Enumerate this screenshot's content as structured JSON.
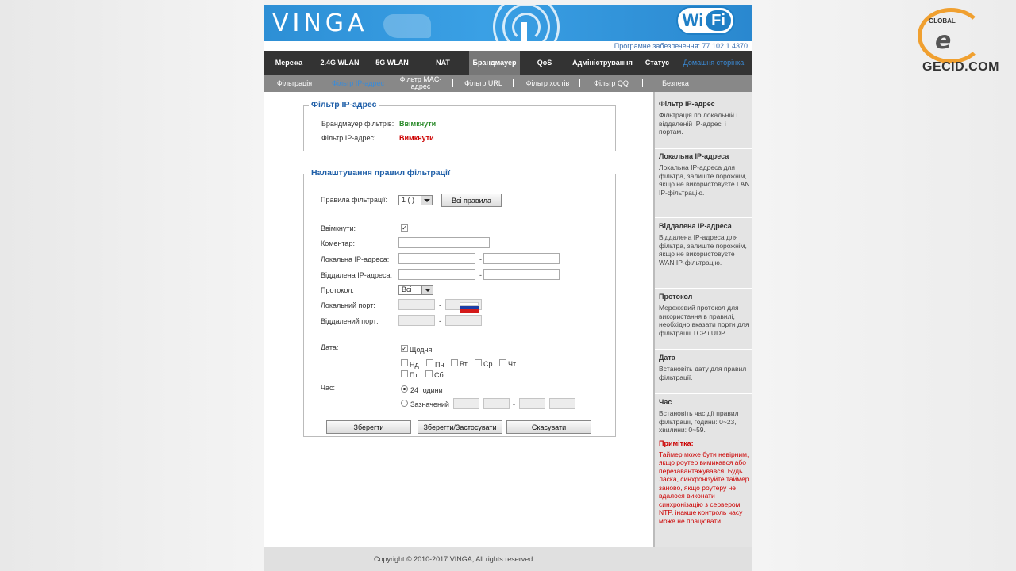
{
  "header": {
    "logo": "VINGA",
    "wifi_wi": "Wi",
    "wifi_fi": "Fi",
    "firmware": "Програмне забезпечення: 77.102.1.4370"
  },
  "nav": {
    "items": [
      "Мережа",
      "2.4G WLAN",
      "5G WLAN",
      "NAT",
      "Брандмауер",
      "QoS",
      "Адміністрування",
      "Статус",
      "Домашня сторінка"
    ]
  },
  "subnav": {
    "items": [
      "Фільтрація",
      "Фільтр IP-адрес",
      "Фільтр MAC-адрес",
      "Фільтр URL",
      "Фільтр хостів",
      "Фільтр QQ",
      "Безпека"
    ]
  },
  "ip_filter": {
    "legend": "Фільтр IP-адрес",
    "firewall_label": "Брандмауер фільтрів:",
    "firewall_value": "Ввімкнути",
    "ipfilter_label": "Фільтр IP-адрес:",
    "ipfilter_value": "Вимкнути"
  },
  "rules": {
    "legend": "Налаштування правил фільтрації",
    "rules_label": "Правила фільтрації:",
    "rules_value": "1 ( )",
    "all_rules_button": "Всі правила",
    "enable_label": "Ввімкнути:",
    "comment_label": "Коментар:",
    "local_ip_label": "Локальна IP-адреса:",
    "remote_ip_label": "Віддалена IP-адреса:",
    "protocol_label": "Протокол:",
    "protocol_value": "Всі",
    "local_port_label": "Локальний порт:",
    "remote_port_label": "Віддалений порт:",
    "date_label": "Дата:",
    "daily_label": "Щодня",
    "days": [
      "Нд",
      "Пн",
      "Вт",
      "Ср",
      "Чт",
      "Пт",
      "Сб"
    ],
    "time_label": "Час:",
    "time_24h": "24 години",
    "time_custom": "Зазначений",
    "dash": "-",
    "save_button": "Зберегти",
    "save_apply_button": "Зберегти/Застосувати",
    "cancel_button": "Скасувати"
  },
  "help": {
    "blocks": [
      {
        "title": "Фільтр IP-адрес",
        "text": "Фільтрація по локальній і віддаленій IP-адресі і портам."
      },
      {
        "title": "Локальна IP-адреса",
        "text": "Локальна IP-адреса для фільтра, залиште порожнім, якщо не використовуєте LAN IP-фільтрацію."
      },
      {
        "title": "Віддалена IP-адреса",
        "text": "Віддалена IP-адреса для фільтра, залиште порожнім, якщо не використовуєте WAN IP-фільтрацію."
      },
      {
        "title": "Протокол",
        "text": "Мережевий протокол для використання в правилі, необхідно вказати порти для фільтрації TCP і UDP."
      },
      {
        "title": "Дата",
        "text": "Встановіть дату для правил фільтрації."
      },
      {
        "title": "Час",
        "text": "Встановіть час дії правил фільтрації, години: 0~23, хвилини: 0~59."
      }
    ],
    "note_title": "Примітка:",
    "note_text": "Таймер може бути невірним, якщо роутер вимикався або перезавантажувався. Будь ласка, синхронізуйте таймер заново, якщо роутеру не вдалося виконати синхронізацію з сервером NTP, інакше контроль часу може не працювати."
  },
  "footer": {
    "copyright": "Copyright © 2010-2017 VINGA, All rights reserved."
  },
  "watermark": {
    "global": "GLOBAL",
    "brand": "GECID.COM"
  },
  "colors": {
    "banner_blue": "#2d8fd5",
    "nav_dark": "#333333",
    "subnav_grey": "#888888",
    "legend_blue": "#1f5fa8",
    "status_green": "#2a8a2a",
    "status_red": "#cc0000"
  }
}
